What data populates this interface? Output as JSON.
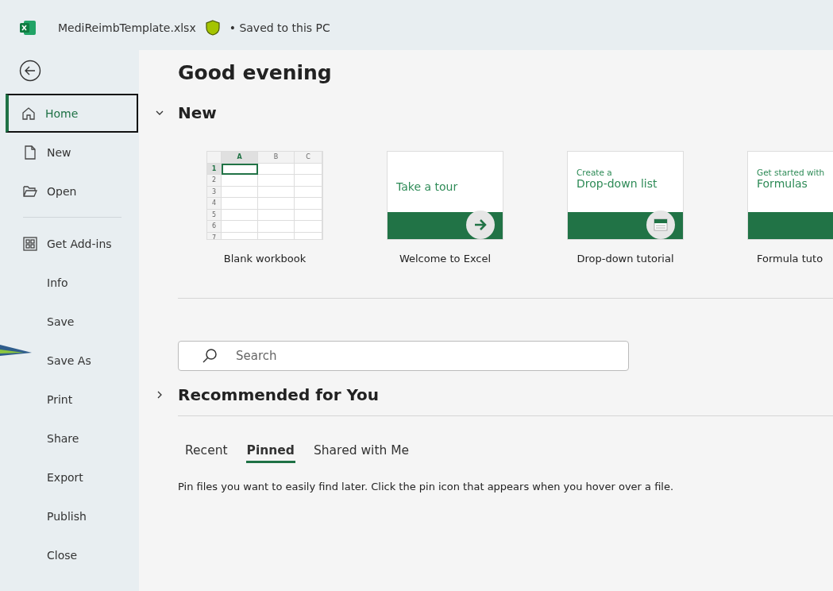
{
  "title_bar": {
    "file_name": "MediReimbTemplate.xlsx",
    "status": "• Saved to this PC"
  },
  "sidebar": {
    "sections": [
      [
        {
          "label": "Home",
          "selected": true
        },
        {
          "label": "New",
          "selected": false
        },
        {
          "label": "Open",
          "selected": false
        }
      ],
      [
        {
          "label": "Get Add-ins",
          "selected": false
        },
        {
          "label": "Info",
          "selected": false
        },
        {
          "label": "Save",
          "selected": false
        },
        {
          "label": "Save As",
          "selected": false
        },
        {
          "label": "Print",
          "selected": false
        },
        {
          "label": "Share",
          "selected": false
        },
        {
          "label": "Export",
          "selected": false
        },
        {
          "label": "Publish",
          "selected": false
        },
        {
          "label": "Close",
          "selected": false
        }
      ]
    ]
  },
  "greeting": "Good evening",
  "new_section": {
    "title": "New",
    "expanded": true,
    "templates": [
      {
        "kind": "blank",
        "label": "Blank workbook",
        "columns": [
          "A",
          "B",
          "C"
        ],
        "rows": [
          "1",
          "2",
          "3",
          "4",
          "5",
          "6",
          "7"
        ]
      },
      {
        "kind": "tour",
        "label": "Welcome to Excel",
        "lines": [
          "Take a tour"
        ]
      },
      {
        "kind": "tutorial",
        "label": "Drop-down tutorial",
        "lines": [
          "Create a",
          "Drop-down list"
        ]
      },
      {
        "kind": "tutorial_cut",
        "label": "Formula tuto",
        "lines": [
          "Get started with",
          "Formulas"
        ]
      }
    ]
  },
  "search": {
    "placeholder": "Search"
  },
  "recommended": {
    "title": "Recommended for You",
    "expanded": false
  },
  "tabs": [
    {
      "label": "Recent",
      "selected": false
    },
    {
      "label": "Pinned",
      "selected": true
    },
    {
      "label": "Shared with Me",
      "selected": false
    }
  ],
  "message": "Pin files you want to easily find later. Click the pin icon that appears when you hover over a file."
}
